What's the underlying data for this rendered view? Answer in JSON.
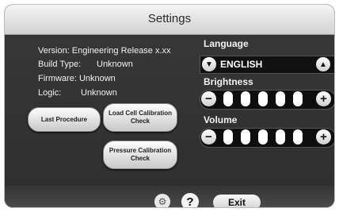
{
  "title": "Settings",
  "info": {
    "version": "Version: Engineering Release x.xx",
    "build_type_label": "Build Type:",
    "build_type_value": "Unknown",
    "firmware": "Firmware: Unknown",
    "logic_label": "Logic:",
    "logic_value": "Unknown"
  },
  "buttons": {
    "last_procedure": "Last Procedure",
    "load_cell": "Load Cell Calibration Check",
    "pressure": "Pressure Calibration Check",
    "exit": "Exit",
    "help": "?"
  },
  "language": {
    "label": "Language",
    "value": "ENGLISH"
  },
  "brightness": {
    "label": "Brightness",
    "level": 5,
    "max": 5
  },
  "volume": {
    "label": "Volume",
    "level": 5,
    "max": 5
  },
  "icons": {
    "gear": "gear-icon",
    "help": "help-icon",
    "arrow_down": "triangle-down-icon",
    "arrow_up": "triangle-up-icon",
    "minus": "minus-icon",
    "plus": "plus-icon"
  }
}
